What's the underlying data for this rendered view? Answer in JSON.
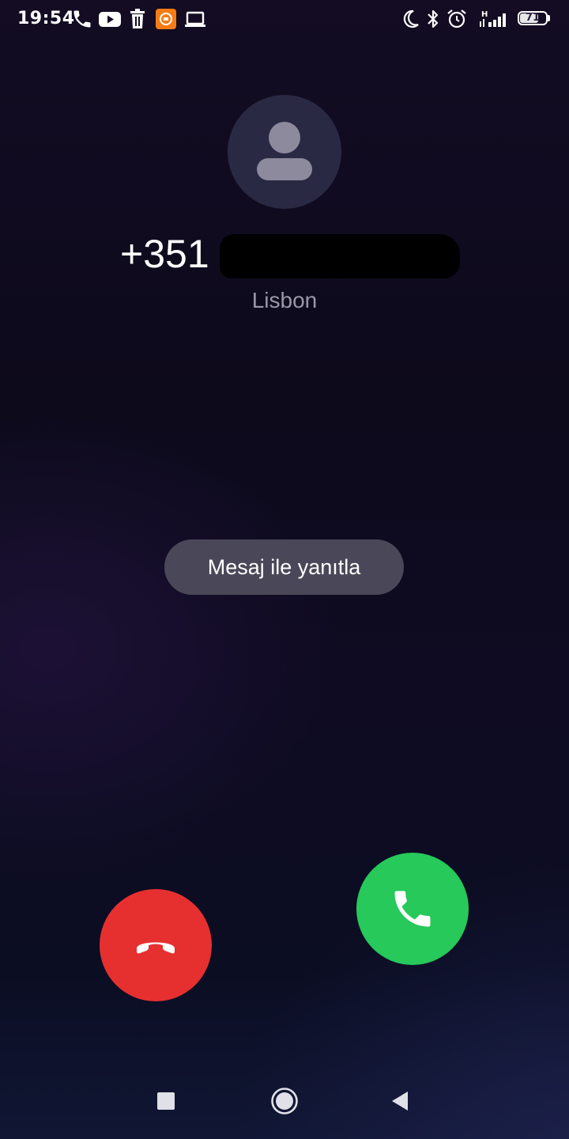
{
  "status_bar": {
    "time": "19:54",
    "network_type": "H",
    "battery_level": "71",
    "battery_fraction": 0.71,
    "left_icons": [
      "phone-icon",
      "youtube-icon",
      "trash-icon",
      "mi-app-icon",
      "laptop-icon"
    ],
    "right_icons": [
      "moon-icon",
      "bluetooth-icon",
      "alarm-icon",
      "signal-icon",
      "battery-icon"
    ]
  },
  "caller": {
    "avatar_icon": "person-icon",
    "number_prefix": "+351",
    "location": "Lisbon"
  },
  "actions": {
    "reply_with_message": "Mesaj ile yanıtla",
    "decline_icon": "phone-hangup-icon",
    "answer_icon": "phone-answer-icon"
  },
  "colors": {
    "decline": "#e63030",
    "answer": "#26c95a",
    "reply_pill": "#4a4858"
  },
  "nav_bar": {
    "buttons": [
      "recents-square-icon",
      "home-circle-icon",
      "back-triangle-icon"
    ]
  }
}
